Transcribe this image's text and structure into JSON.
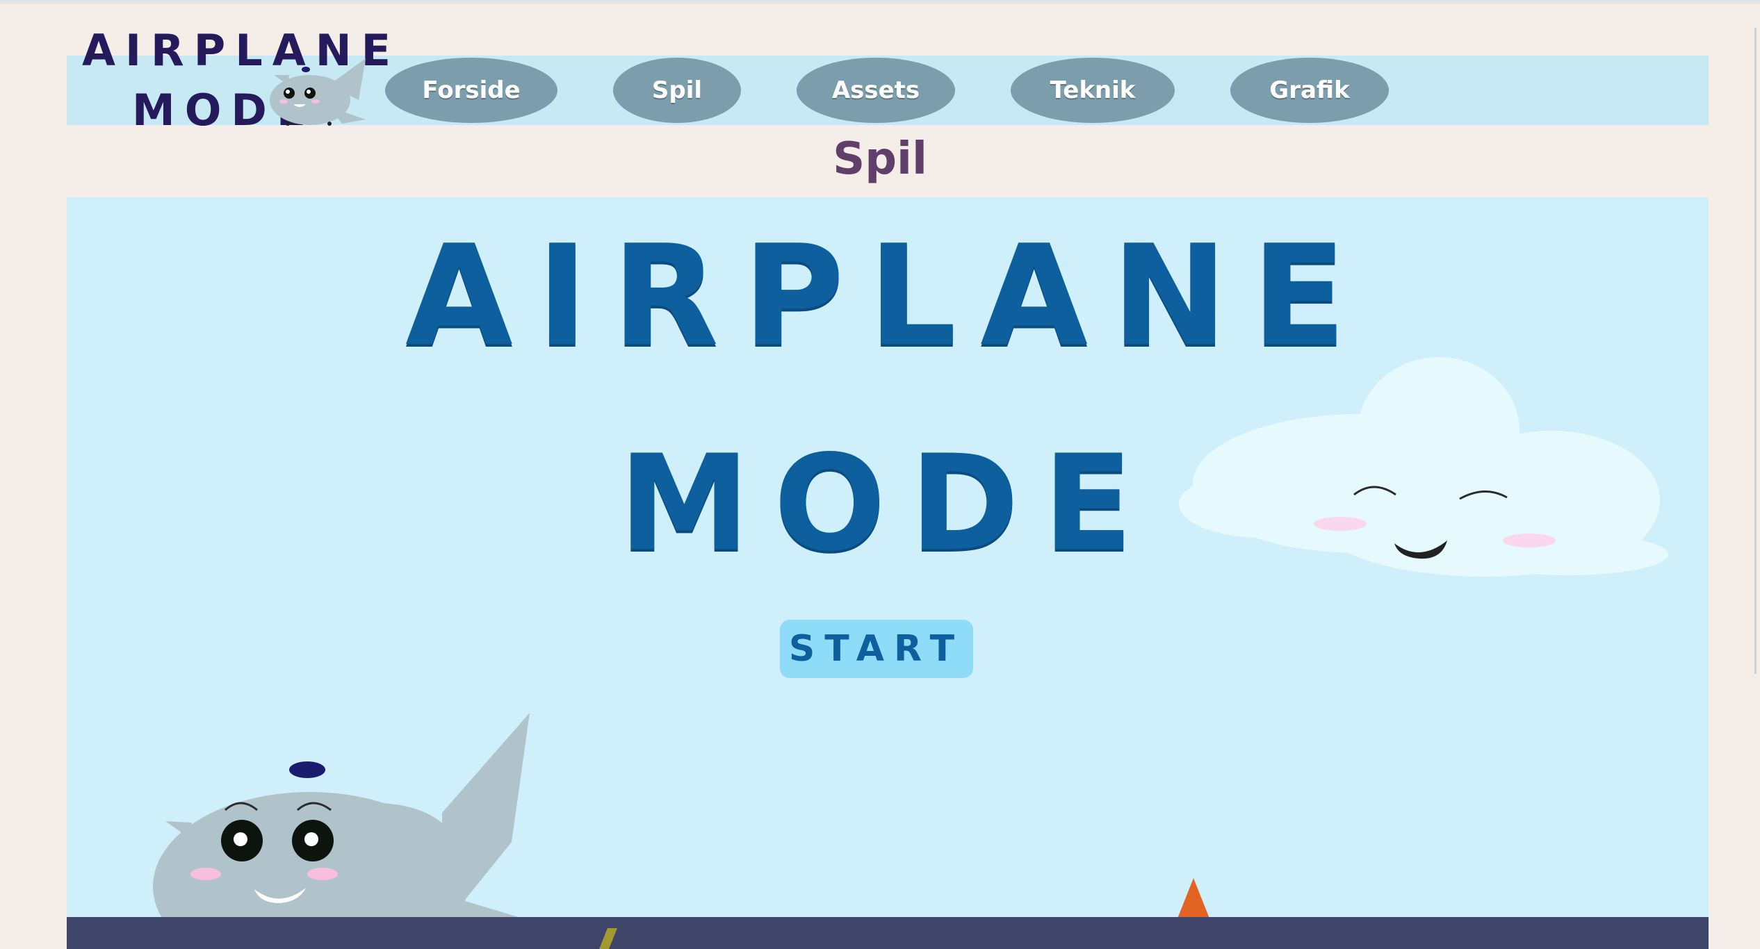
{
  "header": {
    "logo": {
      "line1": "AIRPLANE",
      "line2": "MODE"
    },
    "nav": [
      {
        "label": "Forside"
      },
      {
        "label": "Spil"
      },
      {
        "label": "Assets"
      },
      {
        "label": "Teknik"
      },
      {
        "label": "Grafik"
      }
    ]
  },
  "page": {
    "title": "Spil"
  },
  "game": {
    "title_line1": "AIRPLANE",
    "title_line2": "MODE",
    "start_label": "START"
  },
  "colors": {
    "page_bg": "#f5ede8",
    "nav_bar": "#c6e9f3",
    "nav_button": "#7c9dab",
    "title_blue": "#0e5f9e",
    "game_sky": "#cfeffb",
    "start_button": "#8fdcf8",
    "ground": "#3f4469",
    "page_title": "#603f6a"
  }
}
